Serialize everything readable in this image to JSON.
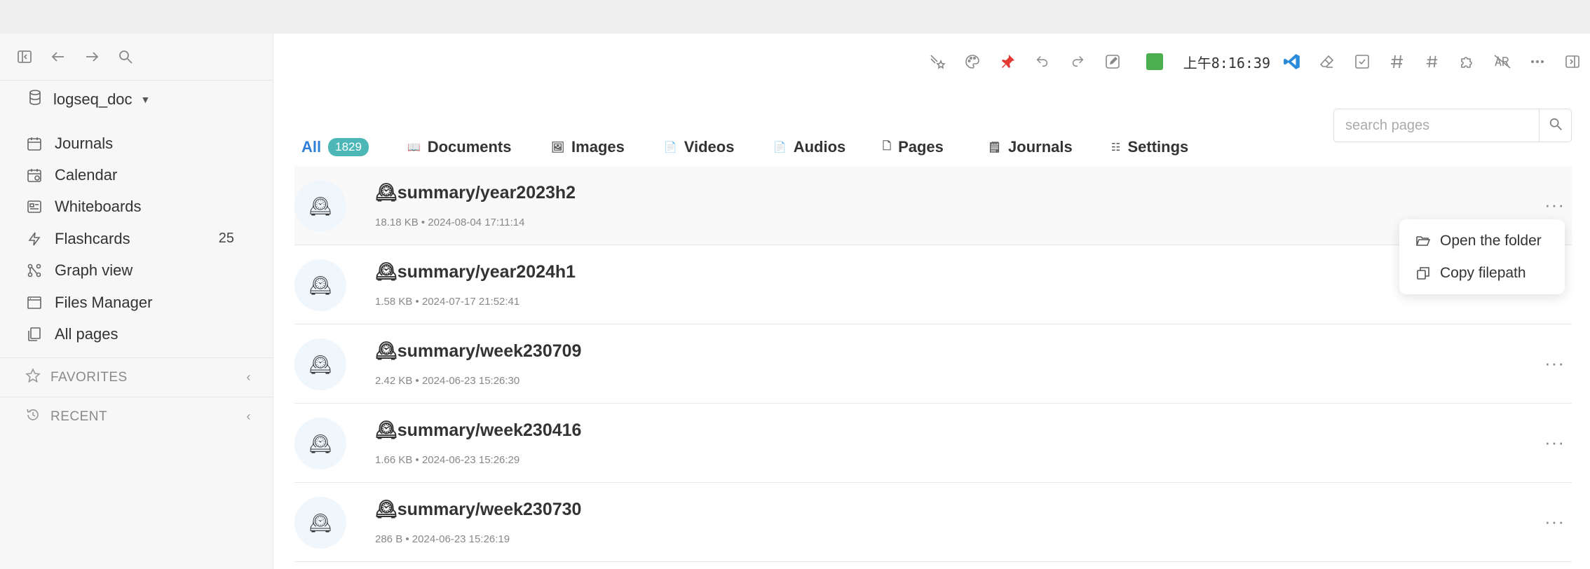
{
  "sidebar": {
    "repo_name": "logseq_doc",
    "nav": [
      {
        "label": "Journals",
        "icon": "calendar-icon"
      },
      {
        "label": "Calendar",
        "icon": "calendar-star-icon"
      },
      {
        "label": "Whiteboards",
        "icon": "whiteboard-icon"
      },
      {
        "label": "Flashcards",
        "icon": "flash-icon",
        "count": "25"
      },
      {
        "label": "Graph view",
        "icon": "graph-icon"
      },
      {
        "label": "Files Manager",
        "icon": "files-icon"
      },
      {
        "label": "All pages",
        "icon": "pages-icon"
      }
    ],
    "favorites_label": "FAVORITES",
    "recent_label": "RECENT"
  },
  "toolbar": {
    "clock": "上午8:16:39"
  },
  "tabs": [
    {
      "label": "All",
      "badge": "1829"
    },
    {
      "label": "Documents"
    },
    {
      "label": "Images"
    },
    {
      "label": "Videos"
    },
    {
      "label": "Audios"
    },
    {
      "label": "Pages"
    },
    {
      "label": "Journals"
    },
    {
      "label": "Settings"
    }
  ],
  "search": {
    "placeholder": "search pages"
  },
  "files": [
    {
      "title": "🕰summary/year2023h2",
      "meta": "18.18 KB • 2024-08-04 17:11:14"
    },
    {
      "title": "🕰summary/year2024h1",
      "meta": "1.58 KB • 2024-07-17 21:52:41"
    },
    {
      "title": "🕰summary/week230709",
      "meta": "2.42 KB • 2024-06-23 15:26:30"
    },
    {
      "title": "🕰summary/week230416",
      "meta": "1.66 KB • 2024-06-23 15:26:29"
    },
    {
      "title": "🕰summary/week230730",
      "meta": "286 B • 2024-06-23 15:26:19"
    }
  ],
  "avatar_glyph": "🕰",
  "more_glyph": "···",
  "context_menu": {
    "open_folder": "Open the folder",
    "copy_filepath": "Copy filepath"
  },
  "colors": {
    "accent": "#2f7fd8",
    "badge": "#4cb7b6",
    "green_square": "#4caf50",
    "pin": "#e53935",
    "vscode": "#2a8ad8"
  }
}
